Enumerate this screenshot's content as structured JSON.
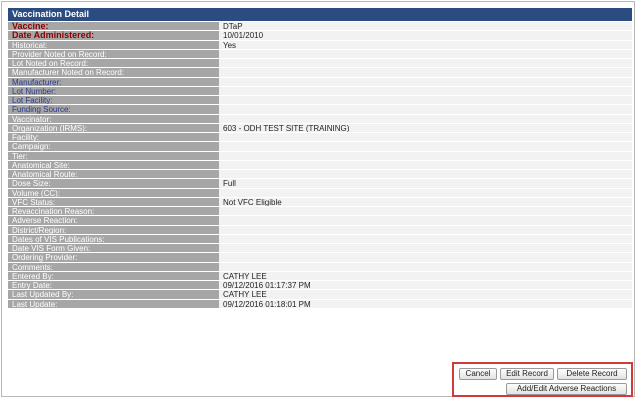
{
  "header": {
    "title": "Vaccination Detail"
  },
  "rows": [
    {
      "label": "Vaccine:",
      "value": "DTaP",
      "style": "required"
    },
    {
      "label": "Date Administered:",
      "value": "10/01/2010",
      "style": "required"
    },
    {
      "label": "Historical:",
      "value": "Yes",
      "style": ""
    },
    {
      "label": "Provider Noted on Record:",
      "value": "",
      "style": ""
    },
    {
      "label": "Lot Noted on Record:",
      "value": "",
      "style": ""
    },
    {
      "label": "Manufacturer Noted on Record:",
      "value": "",
      "style": ""
    },
    {
      "label": "Manufacturer:",
      "value": "",
      "style": "link"
    },
    {
      "label": "Lot Number:",
      "value": "",
      "style": "link"
    },
    {
      "label": "Lot Facility:",
      "value": "",
      "style": "link"
    },
    {
      "label": "Funding Source:",
      "value": "",
      "style": "link"
    },
    {
      "label": "Vaccinator:",
      "value": "",
      "style": ""
    },
    {
      "label": "Organization (IRMS):",
      "value": "603 - ODH TEST SITE (TRAINING)",
      "style": ""
    },
    {
      "label": "Facility:",
      "value": "",
      "style": ""
    },
    {
      "label": "Campaign:",
      "value": "",
      "style": ""
    },
    {
      "label": "Tier:",
      "value": "",
      "style": ""
    },
    {
      "label": "Anatomical Site:",
      "value": "",
      "style": ""
    },
    {
      "label": "Anatomical Route:",
      "value": "",
      "style": ""
    },
    {
      "label": "Dose Size:",
      "value": "Full",
      "style": ""
    },
    {
      "label": "Volume (CC):",
      "value": "",
      "style": ""
    },
    {
      "label": "VFC Status:",
      "value": "Not VFC Eligible",
      "style": ""
    },
    {
      "label": "Revaccination Reason:",
      "value": "",
      "style": ""
    },
    {
      "label": "Adverse Reaction:",
      "value": "",
      "style": ""
    },
    {
      "label": "District/Region:",
      "value": "",
      "style": ""
    },
    {
      "label": "Dates of VIS Publications:",
      "value": "",
      "style": ""
    },
    {
      "label": "Date VIS Form Given:",
      "value": "",
      "style": ""
    },
    {
      "label": "Ordering Provider:",
      "value": "",
      "style": ""
    },
    {
      "label": "Comments:",
      "value": "",
      "style": ""
    },
    {
      "label": "Entered By:",
      "value": "CATHY LEE",
      "style": ""
    },
    {
      "label": "Entry Date:",
      "value": "09/12/2016 01:17:37 PM",
      "style": ""
    },
    {
      "label": "Last Updated By:",
      "value": "CATHY LEE",
      "style": ""
    },
    {
      "label": "Last Update:",
      "value": "09/12/2016 01:18:01 PM",
      "style": ""
    }
  ],
  "buttons": {
    "cancel": "Cancel",
    "edit_record": "Edit Record",
    "delete_record": "Delete Record",
    "adverse_reactions": "Add/Edit Adverse Reactions"
  },
  "colors": {
    "header_bg": "#2b4c80",
    "label_bg": "#a6a6a6",
    "value_bg": "#f2f2f2",
    "required_label": "#8b0000",
    "link_label": "#2d3a8c",
    "highlight_border": "#d23a3a"
  }
}
